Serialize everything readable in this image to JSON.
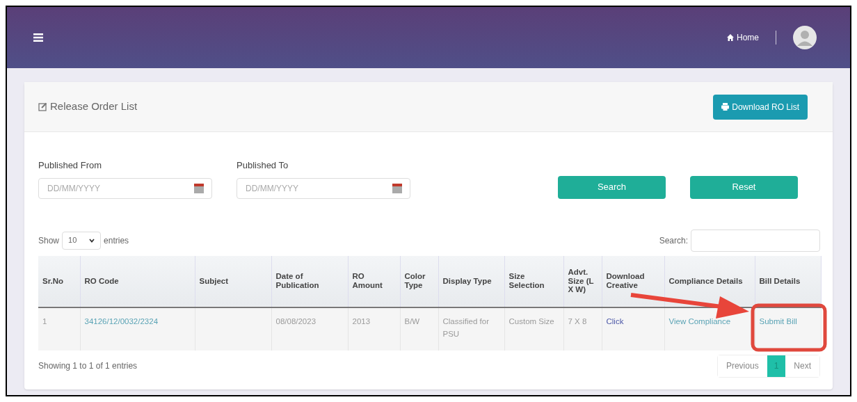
{
  "navbar": {
    "home_link": "Home"
  },
  "card": {
    "title": "Release Order List",
    "download_button": "Download RO List"
  },
  "filters": {
    "from": {
      "label": "Published From",
      "placeholder": "DD/MM/YYYY"
    },
    "to": {
      "label": "Published To",
      "placeholder": "DD/MM/YYYY"
    },
    "search_button": "Search",
    "reset_button": "Reset"
  },
  "length": {
    "show": "Show",
    "value": "10",
    "entries": "entries"
  },
  "table_search": {
    "label": "Search:"
  },
  "table": {
    "columns": [
      "Sr.No",
      "RO Code",
      "Subject",
      "Date of Publication",
      "RO Amount",
      "Color Type",
      "Display Type",
      "Size Selection",
      "Advt. Size (L X W)",
      "Download Creative",
      "Compliance Details",
      "Bill Details"
    ],
    "rows": [
      {
        "cells": [
          {
            "kind": "text",
            "text": "1"
          },
          {
            "kind": "link",
            "text": "34126/12/0032/2324"
          },
          {
            "kind": "empty"
          },
          {
            "kind": "text",
            "text": "08/08/2023"
          },
          {
            "kind": "text",
            "text": "2013"
          },
          {
            "kind": "text",
            "text": "B/W"
          },
          {
            "kind": "text",
            "text": "Classified for PSU"
          },
          {
            "kind": "text",
            "text": "Custom Size"
          },
          {
            "kind": "text",
            "text": "7 X 8"
          },
          {
            "kind": "action",
            "text": "Click"
          },
          {
            "kind": "link",
            "text": "View Compliance"
          },
          {
            "kind": "link",
            "text": "Submit Bill"
          }
        ]
      }
    ]
  },
  "info": "Showing 1 to 1 of 1 entries",
  "pagination": [
    {
      "label": "Previous",
      "selected": false
    },
    {
      "label": "1",
      "selected": true
    },
    {
      "label": "Next",
      "selected": false
    }
  ]
}
